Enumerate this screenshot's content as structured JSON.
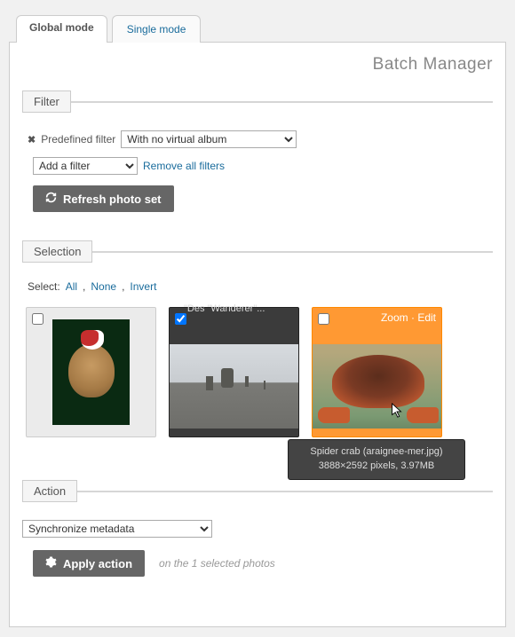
{
  "tabs": {
    "global": "Global mode",
    "single": "Single mode"
  },
  "page_title": "Batch Manager",
  "filter": {
    "legend": "Filter",
    "predefined_label": "Predefined filter",
    "predefined_value": "With no virtual album",
    "add_filter": "Add a filter",
    "remove_all": "Remove all filters",
    "refresh": "Refresh photo set"
  },
  "selection": {
    "legend": "Selection",
    "select_label": "Select:",
    "all": "All",
    "none": "None",
    "invert": "Invert"
  },
  "thumbs": {
    "zoom": "Zoom",
    "edit": "Edit",
    "hover_title_partial": "\"Des \"Wanderer\"..."
  },
  "tooltip": {
    "line1": "Spider crab (araignee-mer.jpg)",
    "line2": "3888×2592 pixels, 3.97MB"
  },
  "action": {
    "legend": "Action",
    "select_value": "Synchronize metadata",
    "apply": "Apply action",
    "status": "on the 1 selected photos"
  }
}
